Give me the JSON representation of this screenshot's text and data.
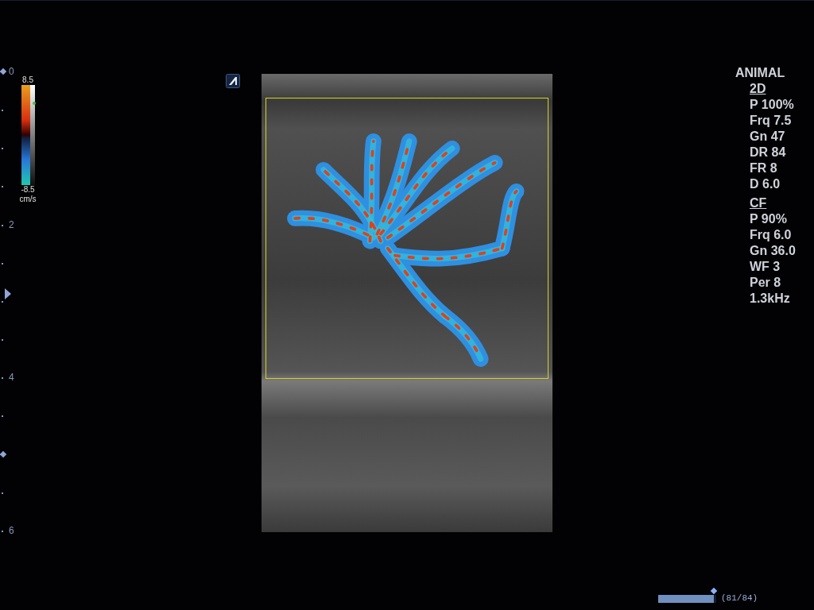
{
  "depth_scale": {
    "labels": [
      "0",
      "2",
      "4",
      "6"
    ]
  },
  "color_bar": {
    "max": "8.5",
    "min": "-8.5",
    "unit": "cm/s"
  },
  "preset": "ANIMAL",
  "parameter_groups": [
    {
      "title": "2D",
      "items": [
        "P 100%",
        "Frq 7.5",
        "Gn 47",
        "DR 84",
        "FR 8",
        "D 6.0"
      ]
    },
    {
      "title": "CF",
      "items": [
        "P 90%",
        "Frq 6.0",
        "Gn 36.0",
        "WF 3",
        "Per 8",
        "1.3kHz"
      ]
    }
  ],
  "cine": {
    "level": 0.96,
    "counter": "(81/84)"
  }
}
